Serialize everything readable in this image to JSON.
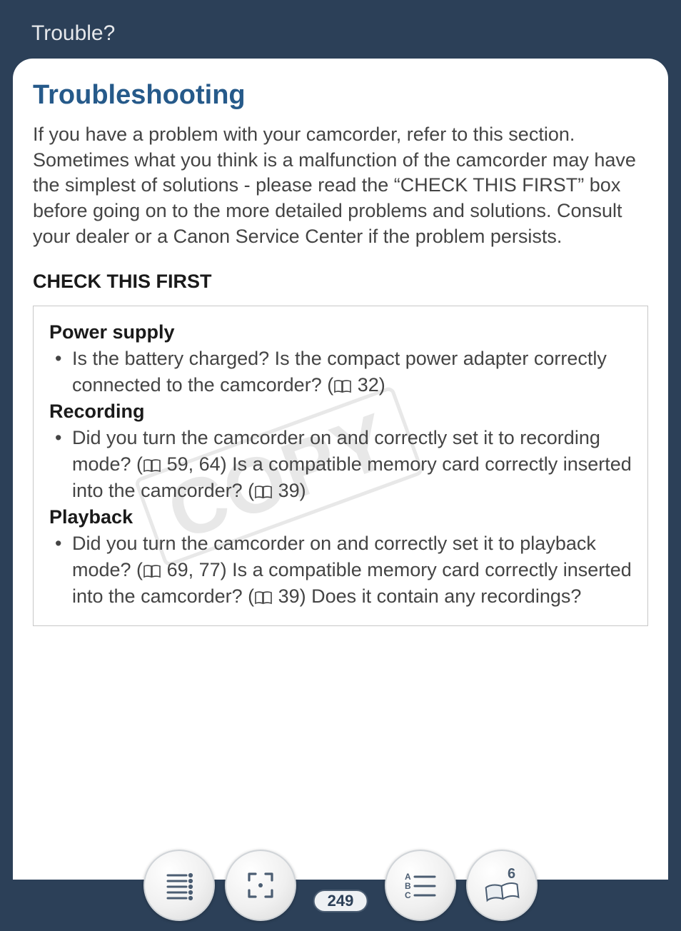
{
  "header": {
    "tab_title": "Trouble?"
  },
  "main": {
    "title": "Troubleshooting",
    "intro": "If you have a problem with your camcorder, refer to this section. Sometimes what you think is a malfunction of the camcorder may have the simplest of solutions - please read the “CHECK THIS FIRST” box before going on to the more detailed problems and solutions. Consult your dealer or a Canon Service Center if the problem persists.",
    "check_heading": "CHECK THIS FIRST",
    "sections": [
      {
        "heading": "Power supply",
        "bullet_pre": "Is the battery charged? Is the compact power adapter correctly connected to the camcorder? (",
        "ref1": " 32)",
        "bullet_mid": "",
        "ref2": "",
        "bullet_post": ""
      },
      {
        "heading": "Recording",
        "bullet_pre": "Did you turn the camcorder on and correctly set it to recording mode? (",
        "ref1": " 59, 64) Is a compatible memory card correctly inserted into the camcorder? (",
        "ref2": " 39)",
        "bullet_post": ""
      },
      {
        "heading": "Playback",
        "bullet_pre": "Did you turn the camcorder on and correctly set it to playback mode? (",
        "ref1": " 69, 77) Is a compatible memory card correctly inserted into the camcorder? (",
        "ref2": " 39) Does it contain any recordings?",
        "bullet_post": ""
      }
    ]
  },
  "watermark": "COPY",
  "toolbar": {
    "toc_label": "table-of-contents",
    "fullscreen_label": "fullscreen",
    "index_label": "alphabetical-index",
    "chapter_number": "6"
  },
  "page_number": "249"
}
